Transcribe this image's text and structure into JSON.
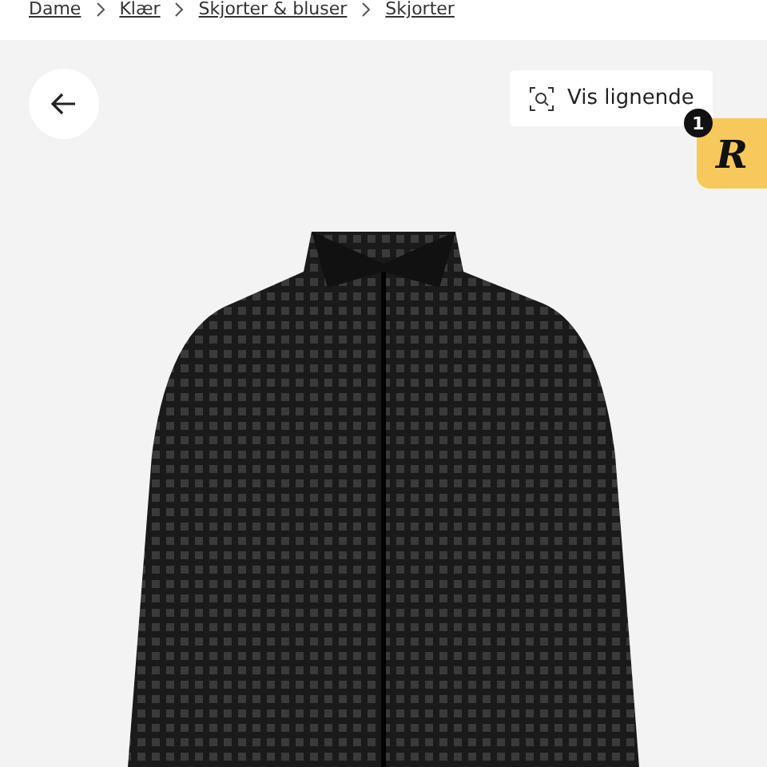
{
  "breadcrumb": [
    "Dame",
    "Klær",
    "Skjorter & bluser",
    "Skjorter"
  ],
  "similar_button": {
    "label": "Vis lignende"
  },
  "extension_badge": {
    "logo": "R",
    "count": "1"
  }
}
